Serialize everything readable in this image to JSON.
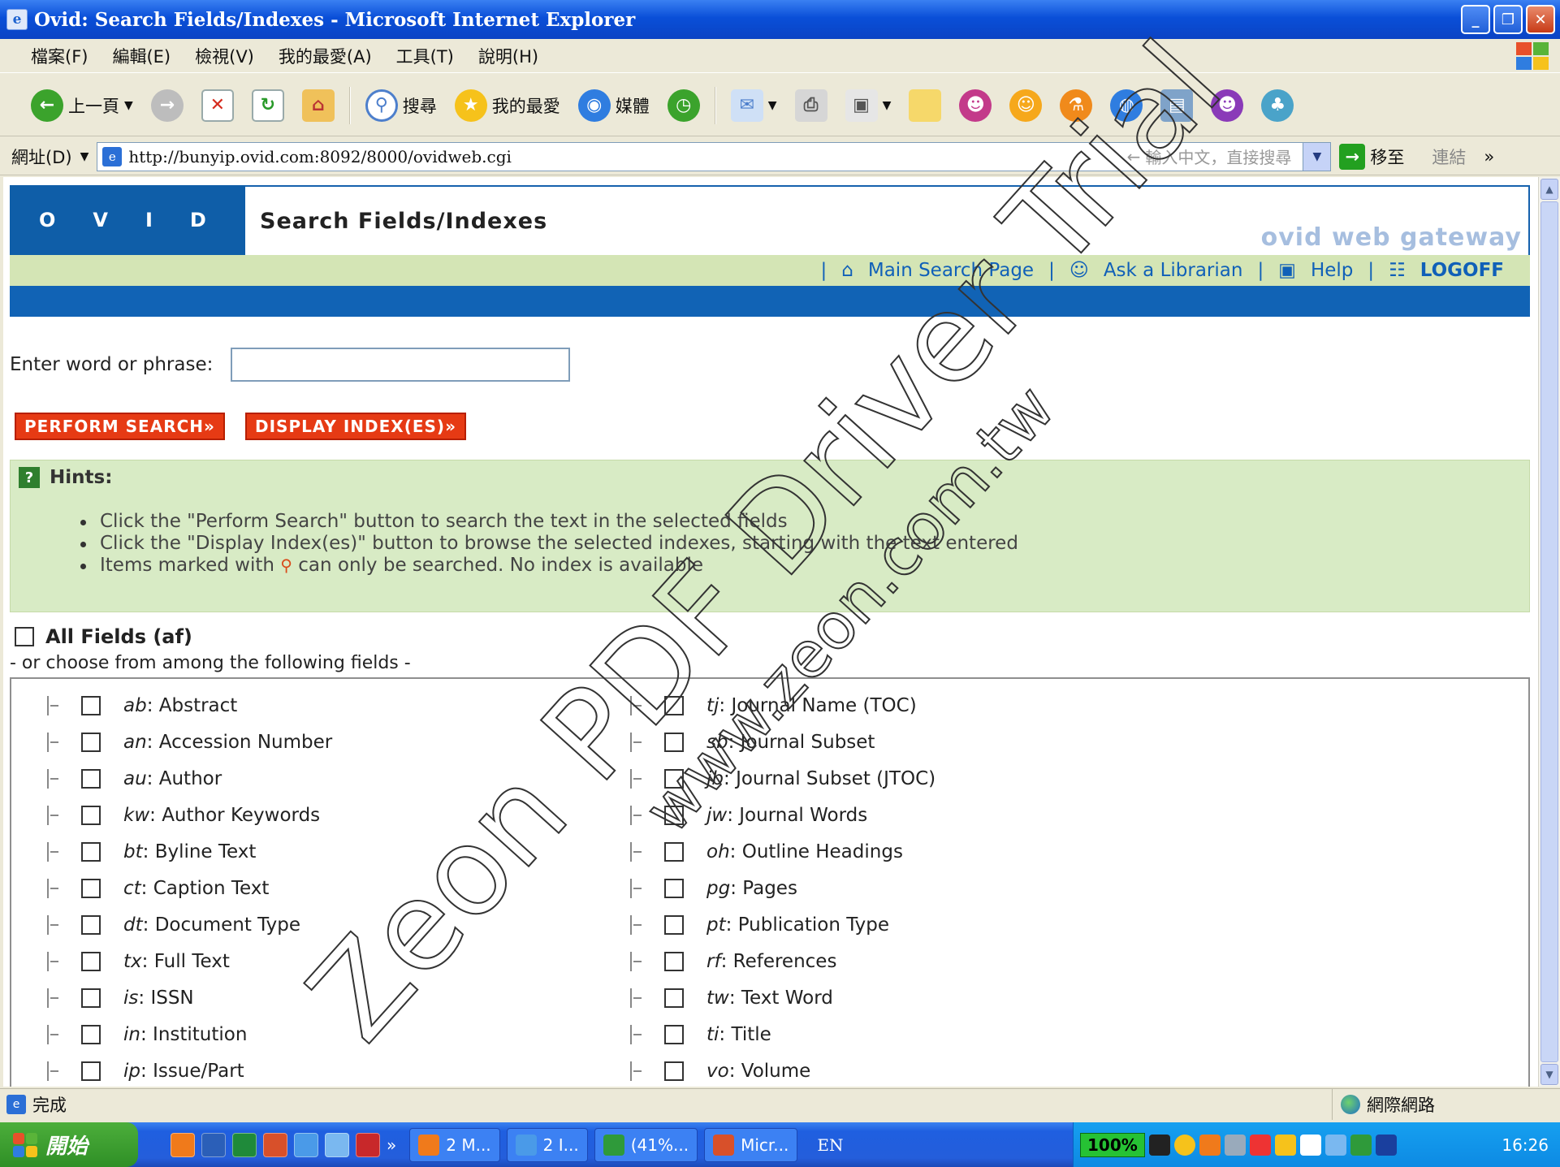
{
  "window": {
    "title": "Ovid: Search Fields/Indexes - Microsoft Internet Explorer",
    "buttons": [
      "_",
      "❐",
      "✕"
    ]
  },
  "menu": [
    "檔案(F)",
    "編輯(E)",
    "檢視(V)",
    "我的最愛(A)",
    "工具(T)",
    "說明(H)"
  ],
  "toolbar": {
    "back": "上一頁",
    "search": "搜尋",
    "favorites": "我的最愛",
    "media": "媒體"
  },
  "address": {
    "label": "網址(D)",
    "url": "http://bunyip.ovid.com:8092/8000/ovidweb.cgi",
    "search_hint": "輸入中文，直接搜尋",
    "go": "移至",
    "links": "連結"
  },
  "ovid": {
    "logo_letters": [
      "O",
      "V",
      "I",
      "D"
    ],
    "page_title": "Search Fields/Indexes",
    "gateway": "ovid web gateway"
  },
  "nav": {
    "main_search": "Main Search Page",
    "ask": "Ask a Librarian",
    "help": "Help",
    "logoff": "LOGOFF"
  },
  "search": {
    "label": "Enter word or phrase:",
    "value": "",
    "perform": "PERFORM SEARCH",
    "display": "DISPLAY INDEX(ES)"
  },
  "hints": {
    "title": "Hints:",
    "items": [
      "Click the \"Perform Search\" button to search the text in the selected fields",
      "Click the \"Display Index(es)\" button to browse the selected indexes, starting with the text entered"
    ],
    "item3_pre": "Items marked with",
    "item3_post": "can only be searched. No index is available"
  },
  "all_fields": "All Fields (af)",
  "or_choose": "- or choose from among the following fields -",
  "fields_left": [
    {
      "code": "ab",
      "name": "Abstract"
    },
    {
      "code": "an",
      "name": "Accession Number"
    },
    {
      "code": "au",
      "name": "Author"
    },
    {
      "code": "kw",
      "name": "Author Keywords"
    },
    {
      "code": "bt",
      "name": "Byline Text"
    },
    {
      "code": "ct",
      "name": "Caption Text"
    },
    {
      "code": "dt",
      "name": "Document Type"
    },
    {
      "code": "tx",
      "name": "Full Text"
    },
    {
      "code": "is",
      "name": "ISSN"
    },
    {
      "code": "in",
      "name": "Institution"
    },
    {
      "code": "ip",
      "name": "Issue/Part"
    }
  ],
  "fields_right": [
    {
      "code": "tj",
      "name": "Journal Name (TOC)"
    },
    {
      "code": "sb",
      "name": "Journal Subset"
    },
    {
      "code": "jb",
      "name": "Journal Subset (JTOC)"
    },
    {
      "code": "jw",
      "name": "Journal Words"
    },
    {
      "code": "oh",
      "name": "Outline Headings"
    },
    {
      "code": "pg",
      "name": "Pages"
    },
    {
      "code": "pt",
      "name": "Publication Type"
    },
    {
      "code": "rf",
      "name": "References"
    },
    {
      "code": "tw",
      "name": "Text Word"
    },
    {
      "code": "ti",
      "name": "Title"
    },
    {
      "code": "vo",
      "name": "Volume"
    }
  ],
  "status": {
    "text": "完成",
    "zone": "網際網路"
  },
  "taskbar": {
    "start": "開始",
    "tasks": [
      "2 M...",
      "2 I...",
      "(41%...",
      "Micr..."
    ],
    "lang": "EN",
    "percent": "100%",
    "time": "16:26"
  },
  "watermark": {
    "line1": "Zeon PDF Driver Trial",
    "line2": "www.zeon.com.tw"
  },
  "colors": {
    "ovid_blue": "#1163b5",
    "hint_green": "#d8ebc5",
    "button_red": "#e63a14",
    "nav_green": "#d4e5b5"
  }
}
